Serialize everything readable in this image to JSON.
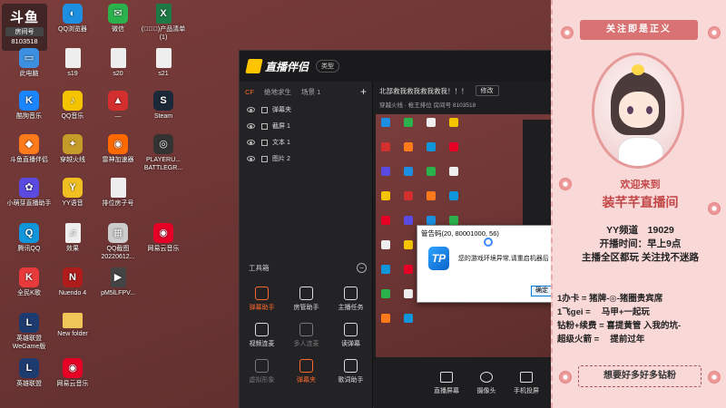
{
  "desktop": {
    "badge": {
      "logo": "斗鱼",
      "tag": "房间号",
      "room_id": "8103518"
    },
    "icons": [
      {
        "label": "QQ浏览器",
        "icon": "qq-browser-icon",
        "color": "#1c8fe0",
        "glyph": "◐"
      },
      {
        "label": "微信",
        "icon": "wechat-icon",
        "color": "#2bb24c",
        "glyph": "✉"
      },
      {
        "label": "(ﾟ∀ﾟ)产品清单(1)",
        "icon": "excel-file-icon",
        "color": "#1d7a44",
        "glyph": "X"
      },
      {
        "label": "此电脑",
        "icon": "this-pc-icon",
        "color": "#3d8fe0",
        "glyph": "▭"
      },
      {
        "label": "s19",
        "icon": "file-icon",
        "color": "#eeeeee",
        "glyph": ""
      },
      {
        "label": "s20",
        "icon": "file-icon",
        "color": "#eeeeee",
        "glyph": ""
      },
      {
        "label": "s21",
        "icon": "file-icon",
        "color": "#eeeeee",
        "glyph": ""
      },
      {
        "label": "酷狗音乐",
        "icon": "kugou-icon",
        "color": "#1a85ff",
        "glyph": "K"
      },
      {
        "label": "QQ音乐",
        "icon": "qq-music-icon",
        "color": "#f5c400",
        "glyph": "♪"
      },
      {
        "label": "—",
        "icon": "red-app-icon",
        "color": "#d32f2f",
        "glyph": "▲"
      },
      {
        "label": "Steam",
        "icon": "steam-icon",
        "color": "#1b2838",
        "glyph": "S"
      },
      {
        "label": "斗鱼直播伴侣",
        "icon": "douyu-companion-icon",
        "color": "#ff7a1a",
        "glyph": "◆"
      },
      {
        "label": "穿越火线",
        "icon": "crossfire-icon",
        "color": "#c59b2a",
        "glyph": "✦"
      },
      {
        "label": "雷神加速器",
        "icon": "leishen-icon",
        "color": "#ff6a00",
        "glyph": "◉"
      },
      {
        "label": "PLAYERU... BATTLEGR...",
        "icon": "pubg-icon",
        "color": "#333333",
        "glyph": "◎"
      },
      {
        "label": "小萌芽直播助手",
        "icon": "streaming-helper-icon",
        "color": "#5b4ae0",
        "glyph": "✿"
      },
      {
        "label": "YY语音",
        "icon": "yy-voice-icon",
        "color": "#f0c020",
        "glyph": "Y"
      },
      {
        "label": "排位房子号",
        "icon": "file-icon",
        "color": "#eeeeee",
        "glyph": ""
      },
      {
        "label": "腾讯QQ",
        "icon": "tencent-qq-icon",
        "color": "#1296db",
        "glyph": "Q"
      },
      {
        "label": "效果",
        "icon": "music-file-icon",
        "color": "#eeeeee",
        "glyph": "♫"
      },
      {
        "label": "QQ截图20220612...",
        "icon": "screenshot-icon",
        "color": "#cccccc",
        "glyph": "▦"
      },
      {
        "label": "网易云音乐",
        "icon": "netease-music-icon",
        "color": "#e60026",
        "glyph": "◉"
      },
      {
        "label": "全民K歌",
        "icon": "karaoke-icon",
        "color": "#e83a3a",
        "glyph": "K"
      },
      {
        "label": "Nuendo 4",
        "icon": "nuendo-icon",
        "color": "#b01c1c",
        "glyph": "N"
      },
      {
        "label": "pM5lLFPV...",
        "icon": "video-file-icon",
        "color": "#444444",
        "glyph": "▶"
      },
      {
        "label": "英雄联盟WeGame版",
        "icon": "lol-wegame-icon",
        "color": "#1e3b70",
        "glyph": "L"
      },
      {
        "label": "New folder",
        "icon": "folder-icon",
        "color": "#f0c659",
        "glyph": ""
      },
      {
        "label": "英雄联盟",
        "icon": "lol-icon",
        "color": "#1e3b70",
        "glyph": "L"
      },
      {
        "label": "网易云音乐",
        "icon": "netease-music-icon",
        "color": "#e60026",
        "glyph": "◉"
      }
    ]
  },
  "app": {
    "title": "直播伴侣",
    "type_button": "类型",
    "scene_tabs": [
      "CF",
      "绝地求生",
      "场景 1"
    ],
    "sources": [
      "弹幕夹",
      "截屏 1",
      "文本 1",
      "图片 2"
    ],
    "toolbox_label": "工具箱",
    "tools": [
      "弹幕助手",
      "房管助手",
      "主播任务",
      "视频连麦",
      "多人连麦",
      "读弹幕",
      "虚拟形象",
      "弹幕夹",
      "歌词助手"
    ],
    "room_title": "北部救我救我救我救我！！！",
    "edit_label": "修改",
    "meta": "穿越火线 · 枪王排位  房间号 8103518",
    "bottom_buttons": [
      "直播屏幕",
      "摄像头",
      "手机投屏"
    ]
  },
  "dialog": {
    "title": "管告码(20, 80001000, 56)",
    "message": "您的游戏环境异常,请重启机器后再试",
    "ok_label": "确定",
    "icon_text": "TP"
  },
  "panel": {
    "follow_banner": "关注即是正义",
    "welcome_line1": "欢迎来到",
    "welcome_line2": "装芊芊直播间",
    "info_lines": [
      "YY频道　19029",
      "开播时间：早上9点",
      "主播全区都玩 关注找不迷路"
    ],
    "rules": [
      "1办卡 = 猪牌-◎-猪圈贵宾席",
      "1飞gei = 　马甲+一起玩",
      "钻粉+续费 = 喜提黄管 入我的坑-",
      "超级火箭 = 　提前过年"
    ],
    "want": "想要好多好多钻粉",
    "colors": {
      "accent": "#c24646",
      "background": "#f9d8d8"
    }
  }
}
